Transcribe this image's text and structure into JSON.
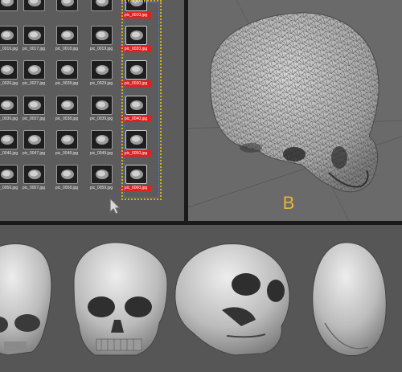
{
  "browser": {
    "thumbnails": [
      [
        "",
        "",
        "",
        "",
        "pic_0010.jpg"
      ],
      [
        "pic_0016.jpg",
        "pic_0017.jpg",
        "pic_0018.jpg",
        "pic_0019.jpg",
        "pic_0020.jpg"
      ],
      [
        "pic_0026.jpg",
        "pic_0027.jpg",
        "pic_0028.jpg",
        "pic_0029.jpg",
        "pic_0030.jpg"
      ],
      [
        "pic_0036.jpg",
        "pic_0037.jpg",
        "pic_0038.jpg",
        "pic_0039.jpg",
        "pic_0040.jpg"
      ],
      [
        "pic_0046.jpg",
        "pic_0047.jpg",
        "pic_0048.jpg",
        "pic_0049.jpg",
        "pic_0050.jpg"
      ],
      [
        "pic_0056.jpg",
        "pic_0057.jpg",
        "pic_0058.jpg",
        "pic_0059.jpg",
        "pic_0060.jpg"
      ]
    ],
    "selected_column": 4,
    "cursor_icon": "arrow-cursor-icon",
    "selection_color": "#d4b020",
    "selected_label_color": "#e02020"
  },
  "viewport": {
    "label": "B",
    "label_color": "#e6b43a",
    "model_icon": "skull-mesh-icon"
  },
  "renders": {
    "views": [
      "skull-side-view",
      "skull-front-view",
      "skull-oblique-view",
      "skull-top-view"
    ]
  }
}
